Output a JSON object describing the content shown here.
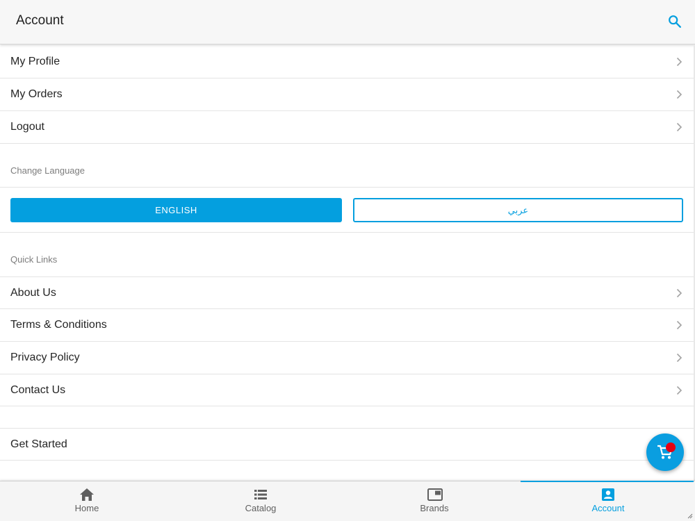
{
  "header": {
    "title": "Account",
    "search_icon": "search-icon"
  },
  "account_menu": [
    {
      "label": "My Profile"
    },
    {
      "label": "My Orders"
    },
    {
      "label": "Logout"
    }
  ],
  "language": {
    "heading": "Change Language",
    "options": [
      {
        "label": "ENGLISH",
        "selected": true
      },
      {
        "label": "عربي",
        "selected": false
      }
    ]
  },
  "quick_links": {
    "heading": "Quick Links",
    "items": [
      {
        "label": "About Us"
      },
      {
        "label": "Terms & Conditions"
      },
      {
        "label": "Privacy Policy"
      },
      {
        "label": "Contact Us"
      }
    ]
  },
  "get_started": {
    "label": "Get Started"
  },
  "cart_fab": {
    "icon": "cart-icon",
    "has_badge": true
  },
  "bottom_nav": [
    {
      "label": "Home",
      "icon": "home-icon",
      "active": false
    },
    {
      "label": "Catalog",
      "icon": "list-icon",
      "active": false
    },
    {
      "label": "Brands",
      "icon": "brands-icon",
      "active": false
    },
    {
      "label": "Account",
      "icon": "account-box-icon",
      "active": true
    }
  ],
  "colors": {
    "accent": "#049fdf",
    "badge": "#e60012",
    "header_bg": "#f7f7f7",
    "nav_bg": "#f5f5f5"
  }
}
